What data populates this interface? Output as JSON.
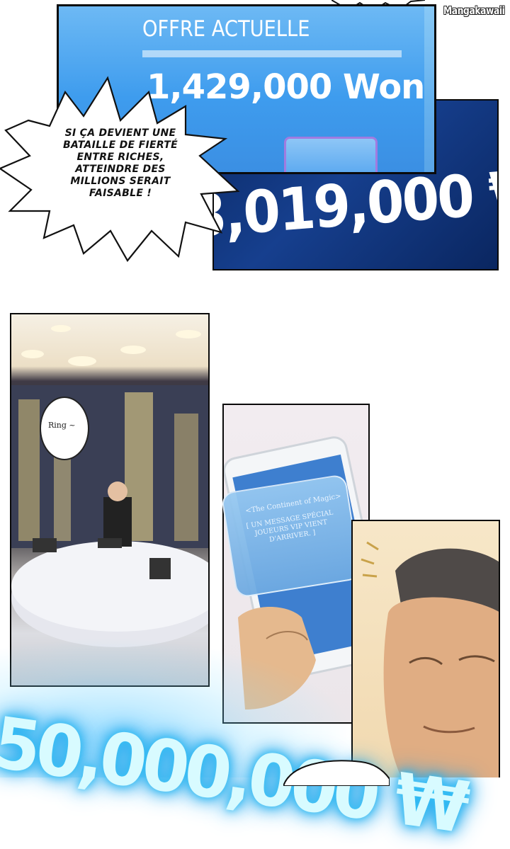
{
  "watermark": "Mangakawaii",
  "panel_top": {
    "offer_label": "OFFRE ACTUELLE",
    "offer_amount": "1,429,000 Won",
    "big_amount": "3,019,000 ₩"
  },
  "speech": {
    "burst_text": "SI ÇA DEVIENT UNE BATAILLE DE FIERTÉ ENTRE RICHES, ATTEINDRE DES MILLIONS SERAIT FAISABLE !",
    "ring": "Ring ~"
  },
  "phone": {
    "title": "<The Continent of Magic>",
    "message": "[ UN MESSAGE SPÉCIAL JOUEURS VIP VIENT D'ARRIVER. ]"
  },
  "bottom_glow": "50,000,000 ₩"
}
